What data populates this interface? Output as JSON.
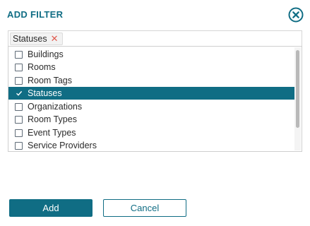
{
  "dialog": {
    "title": "ADD FILTER",
    "close_icon": "close-circle-icon"
  },
  "selected_chips": [
    {
      "label": "Statuses",
      "remove_icon": "close-icon"
    }
  ],
  "options": [
    {
      "label": "Buildings",
      "checked": false
    },
    {
      "label": "Rooms",
      "checked": false
    },
    {
      "label": "Room Tags",
      "checked": false
    },
    {
      "label": "Statuses",
      "checked": true
    },
    {
      "label": "Organizations",
      "checked": false
    },
    {
      "label": "Room Types",
      "checked": false
    },
    {
      "label": "Event Types",
      "checked": false
    },
    {
      "label": "Service Providers",
      "checked": false
    }
  ],
  "buttons": {
    "add_label": "Add",
    "cancel_label": "Cancel"
  },
  "colors": {
    "accent": "#106d84",
    "chip_remove": "#e05a4e"
  }
}
